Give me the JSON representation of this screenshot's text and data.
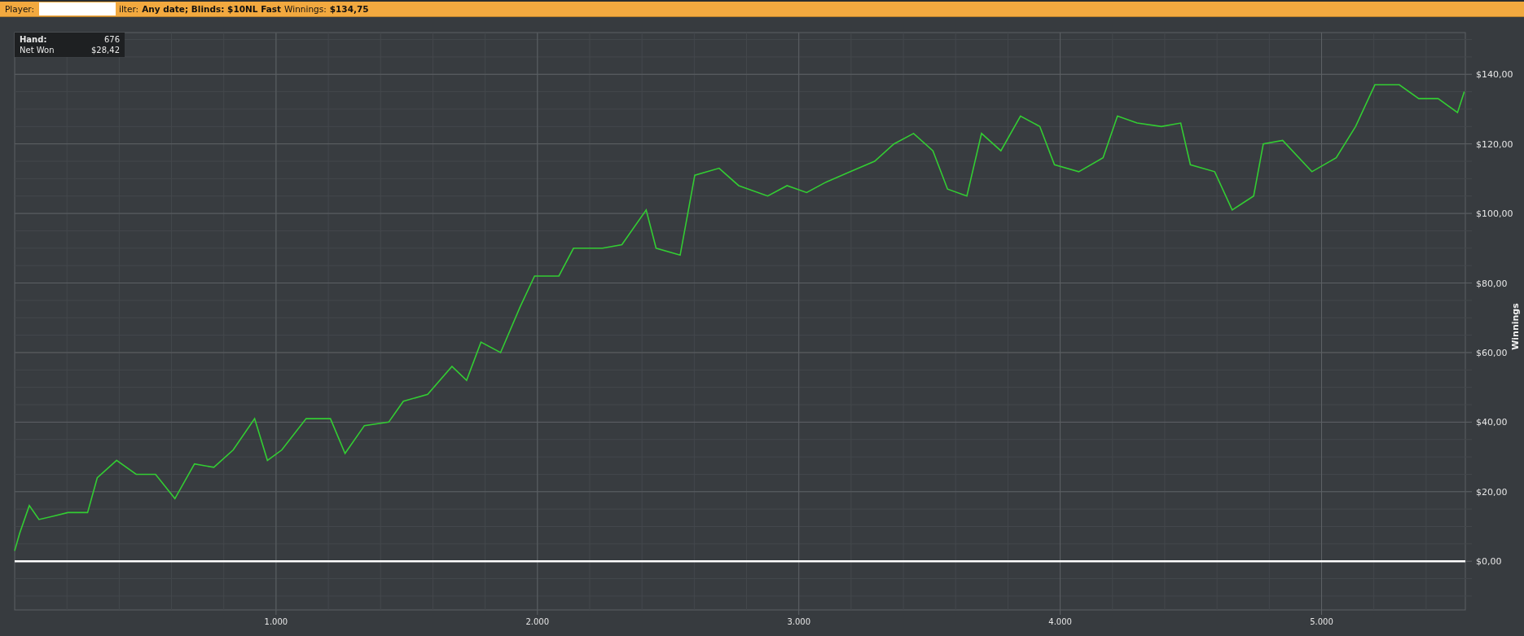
{
  "header": {
    "player_label": "Player:",
    "filter_label": "ilter:",
    "filter_value": "Any date; Blinds: $10NL Fast",
    "winnings_label": "Winnings:",
    "winnings_value": "$134,75"
  },
  "tooltip": {
    "rows": [
      {
        "label": "Hand:",
        "value": "676"
      },
      {
        "label": "Net Won",
        "value": "$28,42"
      }
    ]
  },
  "chart": {
    "chart_data": {
      "type": "line",
      "ylabel": "Winnings",
      "x": [
        0,
        19,
        56,
        93,
        149,
        204,
        279,
        316,
        390,
        465,
        539,
        613,
        688,
        762,
        836,
        918,
        967,
        1022,
        1115,
        1208,
        1264,
        1338,
        1431,
        1487,
        1580,
        1673,
        1729,
        1784,
        1859,
        1933,
        1989,
        2082,
        2138,
        2249,
        2323,
        2416,
        2454,
        2546,
        2602,
        2695,
        2770,
        2881,
        2955,
        3030,
        3104,
        3197,
        3290,
        3364,
        3439,
        3513,
        3569,
        3643,
        3699,
        3773,
        3848,
        3922,
        3978,
        4071,
        4164,
        4219,
        4294,
        4387,
        4461,
        4498,
        4591,
        4658,
        4740,
        4777,
        4851,
        4963,
        5056,
        5130,
        5204,
        5297,
        5372,
        5446,
        5520,
        5546
      ],
      "series": [
        {
          "color": "#33cc33",
          "values": [
            3,
            8,
            16,
            12,
            13,
            14,
            14,
            24,
            29,
            25,
            25,
            18,
            28,
            27,
            32,
            41,
            29,
            32,
            41,
            41,
            31,
            39,
            40,
            46,
            48,
            56,
            52,
            63,
            60,
            73,
            82,
            82,
            90,
            90,
            91,
            101,
            90,
            88,
            111,
            113,
            108,
            105,
            108,
            106,
            109,
            112,
            115,
            120,
            123,
            118,
            107,
            105,
            123,
            118,
            128,
            125,
            114,
            112,
            116,
            128,
            126,
            125,
            126,
            114,
            112,
            101,
            105,
            120,
            121,
            112,
            116,
            125,
            137,
            137,
            133,
            133,
            129,
            135
          ]
        }
      ],
      "grid": true,
      "xlim": [
        0,
        5550
      ],
      "ylim": [
        -14,
        152
      ],
      "xticks": [
        {
          "value": 1000,
          "label": "1.000"
        },
        {
          "value": 2000,
          "label": "2.000"
        },
        {
          "value": 3000,
          "label": "3.000"
        },
        {
          "value": 4000,
          "label": "4.000"
        },
        {
          "value": 5000,
          "label": "5.000"
        }
      ],
      "yticks": [
        {
          "value": 0,
          "label": "$0,00"
        },
        {
          "value": 20,
          "label": "$20,00"
        },
        {
          "value": 40,
          "label": "$40,00"
        },
        {
          "value": 60,
          "label": "$60,00"
        },
        {
          "value": 80,
          "label": "$80,00"
        },
        {
          "value": 100,
          "label": "$100,00"
        },
        {
          "value": 120,
          "label": "$120,00"
        },
        {
          "value": 140,
          "label": "$140,00"
        }
      ]
    }
  }
}
